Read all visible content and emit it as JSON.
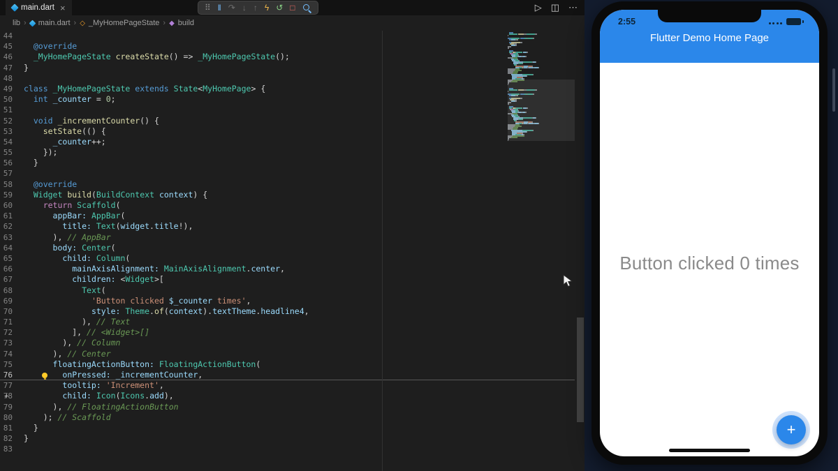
{
  "colors": {
    "editor_background": "#1e1e1e",
    "appbar_blue": "#2b87ea",
    "fab_blue": "#2b87ea",
    "desktop_background": "#131c2e",
    "keyword": "#569cd6",
    "type": "#4ec9b0",
    "string": "#ce9178",
    "comment": "#6a9955"
  },
  "titlebar": {
    "tab_label": "main.dart",
    "close_glyph": "×"
  },
  "debug_toolbar": {
    "icons": [
      {
        "name": "grip-handle-icon",
        "glyph": "⠿",
        "color": "#8a8a8a"
      },
      {
        "name": "pause-icon",
        "glyph": "‖",
        "color": "#75beff"
      },
      {
        "name": "step-over-icon",
        "glyph": "↷",
        "color": "#6e6e6e"
      },
      {
        "name": "step-into-icon",
        "glyph": "↓",
        "color": "#6e6e6e"
      },
      {
        "name": "step-out-icon",
        "glyph": "↑",
        "color": "#6e6e6e"
      },
      {
        "name": "hot-reload-icon",
        "glyph": "ϟ",
        "color": "#edb54a"
      },
      {
        "name": "restart-icon",
        "glyph": "↺",
        "color": "#89d185"
      },
      {
        "name": "stop-icon",
        "glyph": "□",
        "color": "#f26d63"
      },
      {
        "name": "search-icon",
        "kind": "magnifier",
        "color": "#75beff"
      }
    ]
  },
  "editor_actions": {
    "icons": [
      {
        "name": "run-button",
        "glyph": "▷"
      },
      {
        "name": "split-editor-button",
        "glyph": "◫"
      },
      {
        "name": "more-actions-button",
        "glyph": "⋯"
      }
    ]
  },
  "breadcrumb": {
    "separator": "›",
    "items": [
      "lib",
      "main.dart",
      "_MyHomePageState",
      "build"
    ],
    "icons": {
      "class_glyph": "◇",
      "method_glyph": "◆"
    }
  },
  "editor": {
    "current_line": 76,
    "plus_marker_line": 78,
    "lines": [
      {
        "n": 44,
        "t": []
      },
      {
        "n": 45,
        "t": [
          [
            "  ",
            "p"
          ],
          [
            "@override",
            "k"
          ]
        ]
      },
      {
        "n": 46,
        "t": [
          [
            "  ",
            "p"
          ],
          [
            "_MyHomePageState",
            "t"
          ],
          [
            " ",
            "p"
          ],
          [
            "createState",
            "f"
          ],
          [
            "() => ",
            "p"
          ],
          [
            "_MyHomePageState",
            "t"
          ],
          [
            "();",
            "p"
          ]
        ]
      },
      {
        "n": 47,
        "t": [
          [
            "}",
            "p"
          ]
        ]
      },
      {
        "n": 48,
        "t": []
      },
      {
        "n": 49,
        "t": [
          [
            "class ",
            "k"
          ],
          [
            "_MyHomePageState",
            "t"
          ],
          [
            " ",
            "p"
          ],
          [
            "extends ",
            "k"
          ],
          [
            "State",
            "t"
          ],
          [
            "<",
            "p"
          ],
          [
            "MyHomePage",
            "t"
          ],
          [
            "> {",
            "p"
          ]
        ]
      },
      {
        "n": 50,
        "t": [
          [
            "  ",
            "p"
          ],
          [
            "int ",
            "k"
          ],
          [
            "_counter",
            "v"
          ],
          [
            " = ",
            "p"
          ],
          [
            "0",
            "n"
          ],
          [
            ";",
            "p"
          ]
        ]
      },
      {
        "n": 51,
        "t": []
      },
      {
        "n": 52,
        "t": [
          [
            "  ",
            "p"
          ],
          [
            "void ",
            "k"
          ],
          [
            "_incrementCounter",
            "f"
          ],
          [
            "() {",
            "p"
          ]
        ]
      },
      {
        "n": 53,
        "t": [
          [
            "    ",
            "p"
          ],
          [
            "setState",
            "f"
          ],
          [
            "(() {",
            "p"
          ]
        ]
      },
      {
        "n": 54,
        "t": [
          [
            "      ",
            "p"
          ],
          [
            "_counter",
            "v"
          ],
          [
            "++;",
            "p"
          ]
        ]
      },
      {
        "n": 55,
        "t": [
          [
            "    });",
            "p"
          ]
        ]
      },
      {
        "n": 56,
        "t": [
          [
            "  }",
            "p"
          ]
        ]
      },
      {
        "n": 57,
        "t": []
      },
      {
        "n": 58,
        "t": [
          [
            "  ",
            "p"
          ],
          [
            "@override",
            "k"
          ]
        ]
      },
      {
        "n": 59,
        "t": [
          [
            "  ",
            "p"
          ],
          [
            "Widget",
            "t"
          ],
          [
            " ",
            "p"
          ],
          [
            "build",
            "f"
          ],
          [
            "(",
            "p"
          ],
          [
            "BuildContext",
            "t"
          ],
          [
            " ",
            "p"
          ],
          [
            "context",
            "v"
          ],
          [
            ") {",
            "p"
          ]
        ]
      },
      {
        "n": 60,
        "t": [
          [
            "    ",
            "p"
          ],
          [
            "return ",
            "c"
          ],
          [
            "Scaffold",
            "t"
          ],
          [
            "(",
            "p"
          ]
        ]
      },
      {
        "n": 61,
        "t": [
          [
            "      ",
            "p"
          ],
          [
            "appBar: ",
            "v"
          ],
          [
            "AppBar",
            "t"
          ],
          [
            "(",
            "p"
          ]
        ]
      },
      {
        "n": 62,
        "t": [
          [
            "        ",
            "p"
          ],
          [
            "title: ",
            "v"
          ],
          [
            "Text",
            "t"
          ],
          [
            "(",
            "p"
          ],
          [
            "widget",
            "v"
          ],
          [
            ".",
            "p"
          ],
          [
            "title",
            "v"
          ],
          [
            "!),",
            "p"
          ]
        ]
      },
      {
        "n": 63,
        "t": [
          [
            "      ), ",
            "p"
          ],
          [
            "// AppBar",
            "m"
          ]
        ]
      },
      {
        "n": 64,
        "t": [
          [
            "      ",
            "p"
          ],
          [
            "body: ",
            "v"
          ],
          [
            "Center",
            "t"
          ],
          [
            "(",
            "p"
          ]
        ]
      },
      {
        "n": 65,
        "t": [
          [
            "        ",
            "p"
          ],
          [
            "child: ",
            "v"
          ],
          [
            "Column",
            "t"
          ],
          [
            "(",
            "p"
          ]
        ]
      },
      {
        "n": 66,
        "t": [
          [
            "          ",
            "p"
          ],
          [
            "mainAxisAlignment: ",
            "v"
          ],
          [
            "MainAxisAlignment",
            "t"
          ],
          [
            ".",
            "p"
          ],
          [
            "center",
            "v"
          ],
          [
            ",",
            "p"
          ]
        ]
      },
      {
        "n": 67,
        "t": [
          [
            "          ",
            "p"
          ],
          [
            "children: ",
            "v"
          ],
          [
            "<",
            "p"
          ],
          [
            "Widget",
            "t"
          ],
          [
            ">[",
            "p"
          ]
        ]
      },
      {
        "n": 68,
        "t": [
          [
            "            ",
            "p"
          ],
          [
            "Text",
            "t"
          ],
          [
            "(",
            "p"
          ]
        ]
      },
      {
        "n": 69,
        "t": [
          [
            "              ",
            "p"
          ],
          [
            "'Button clicked ",
            "s"
          ],
          [
            "$_counter",
            "v"
          ],
          [
            " times'",
            "s"
          ],
          [
            ",",
            "p"
          ]
        ]
      },
      {
        "n": 70,
        "t": [
          [
            "              ",
            "p"
          ],
          [
            "style: ",
            "v"
          ],
          [
            "Theme",
            "t"
          ],
          [
            ".",
            "p"
          ],
          [
            "of",
            "f"
          ],
          [
            "(",
            "p"
          ],
          [
            "context",
            "v"
          ],
          [
            ").",
            "p"
          ],
          [
            "textTheme",
            "v"
          ],
          [
            ".",
            "p"
          ],
          [
            "headline4",
            "v"
          ],
          [
            ",",
            "p"
          ]
        ]
      },
      {
        "n": 71,
        "t": [
          [
            "            ), ",
            "p"
          ],
          [
            "// Text",
            "m"
          ]
        ]
      },
      {
        "n": 72,
        "t": [
          [
            "          ], ",
            "p"
          ],
          [
            "// <Widget>[]",
            "m"
          ]
        ]
      },
      {
        "n": 73,
        "t": [
          [
            "        ), ",
            "p"
          ],
          [
            "// Column",
            "m"
          ]
        ]
      },
      {
        "n": 74,
        "t": [
          [
            "      ), ",
            "p"
          ],
          [
            "// Center",
            "m"
          ]
        ]
      },
      {
        "n": 75,
        "t": [
          [
            "      ",
            "p"
          ],
          [
            "floatingActionButton: ",
            "v"
          ],
          [
            "FloatingActionButton",
            "t"
          ],
          [
            "(",
            "p"
          ]
        ]
      },
      {
        "n": 76,
        "t": [
          [
            "        ",
            "p"
          ],
          [
            "onPressed: ",
            "v"
          ],
          [
            "_incrementCounter",
            "v"
          ],
          [
            ",",
            "p"
          ]
        ]
      },
      {
        "n": 77,
        "t": [
          [
            "        ",
            "p"
          ],
          [
            "tooltip: ",
            "v"
          ],
          [
            "'Increment'",
            "s"
          ],
          [
            ",",
            "p"
          ]
        ]
      },
      {
        "n": 78,
        "t": [
          [
            "        ",
            "p"
          ],
          [
            "child: ",
            "v"
          ],
          [
            "Icon",
            "t"
          ],
          [
            "(",
            "p"
          ],
          [
            "Icons",
            "t"
          ],
          [
            ".",
            "p"
          ],
          [
            "add",
            "v"
          ],
          [
            "),",
            "p"
          ]
        ]
      },
      {
        "n": 79,
        "t": [
          [
            "      ), ",
            "p"
          ],
          [
            "// FloatingActionButton",
            "m"
          ]
        ]
      },
      {
        "n": 80,
        "t": [
          [
            "    ); ",
            "p"
          ],
          [
            "// Scaffold",
            "m"
          ]
        ]
      },
      {
        "n": 81,
        "t": [
          [
            "  }",
            "p"
          ]
        ]
      },
      {
        "n": 82,
        "t": [
          [
            "}",
            "p"
          ]
        ]
      },
      {
        "n": 83,
        "t": []
      }
    ]
  },
  "simulator": {
    "status_time": "2:55",
    "appbar_title": "Flutter Demo Home Page",
    "body_text": "Button clicked 0 times",
    "fab_glyph": "+"
  }
}
